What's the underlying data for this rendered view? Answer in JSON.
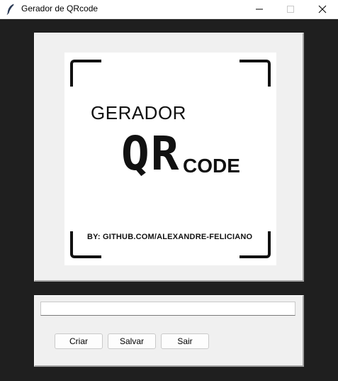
{
  "window": {
    "title": "Gerador de QRcode",
    "icon": "feather-icon"
  },
  "titlebar_buttons": {
    "minimize_icon": "minimize-icon",
    "maximize_icon": "maximize-icon",
    "close_icon": "close-icon"
  },
  "logo": {
    "heading": "GERADOR",
    "qr": "QR",
    "code": "CODE",
    "credit": "BY: GITHUB.COM/ALEXANDRE-FELICIANO"
  },
  "form": {
    "url_value": "",
    "criar_label": "Criar",
    "salvar_label": "Salvar",
    "sair_label": "Sair"
  },
  "colors": {
    "window_bg": "#1f1f1f",
    "panel_bg": "#f0f0f0",
    "logo_ink": "#111111"
  }
}
